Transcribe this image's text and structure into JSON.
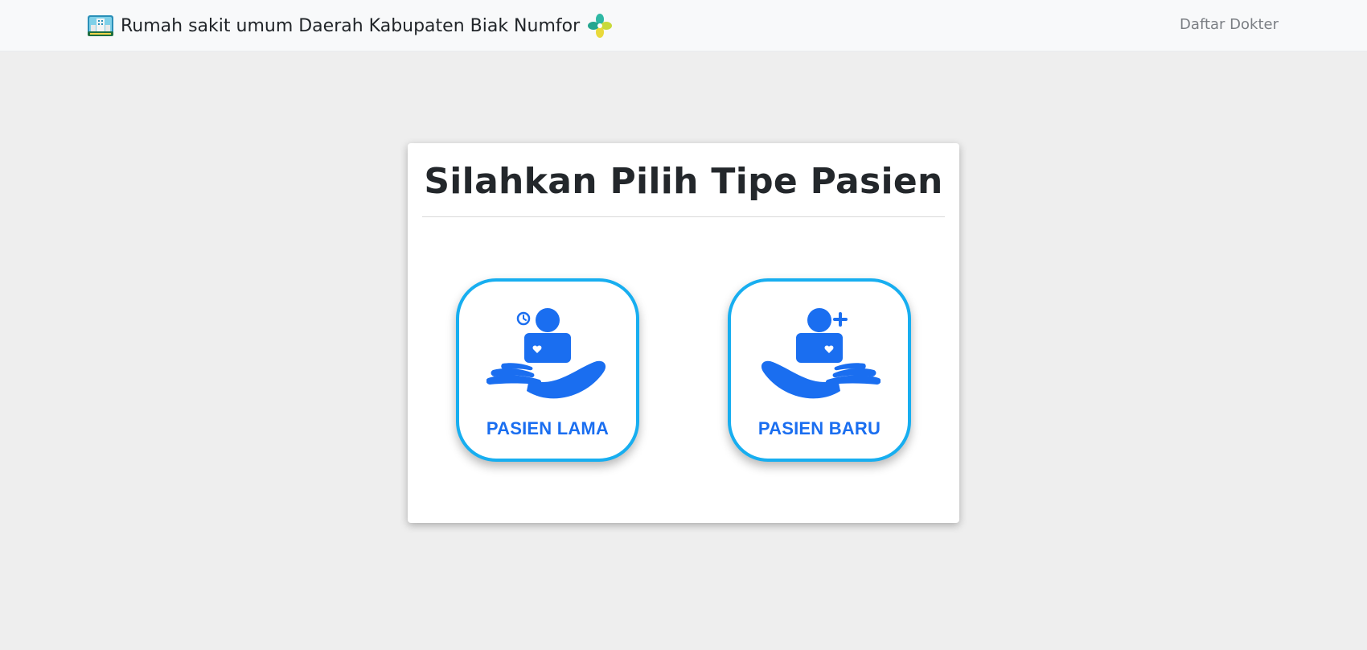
{
  "navbar": {
    "brand_title": "Rumah sakit umum Daerah Kabupaten Biak Numfor",
    "brand_logo_icon": "hospital-building-logo-icon",
    "brand_flower_icon": "health-ministry-flower-logo-icon",
    "link_label": "Daftar Dokter"
  },
  "card": {
    "title": "Silahkan Pilih Tipe Pasien",
    "options": [
      {
        "label": "PASIEN LAMA",
        "icon": "returning-patient-clock-icon"
      },
      {
        "label": "PASIEN BARU",
        "icon": "new-patient-plus-icon"
      }
    ]
  },
  "colors": {
    "accent_blue": "#1a6ef0",
    "card_border_blue": "#17aef0",
    "background": "#eeeeee",
    "navbar_bg": "#f8f9fa"
  }
}
